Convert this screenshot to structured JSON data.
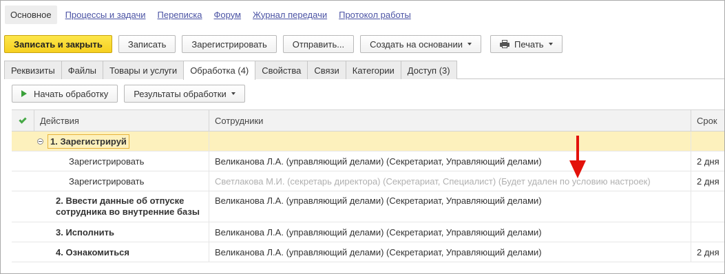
{
  "nav": {
    "items": [
      {
        "label": "Основное",
        "active": true
      },
      {
        "label": "Процессы и задачи"
      },
      {
        "label": "Переписка"
      },
      {
        "label": "Форум"
      },
      {
        "label": "Журнал передачи"
      },
      {
        "label": "Протокол работы"
      }
    ]
  },
  "toolbar": {
    "save_close": "Записать и закрыть",
    "save": "Записать",
    "register": "Зарегистрировать",
    "send": "Отправить...",
    "create_based": "Создать на основании",
    "print": "Печать",
    "print_icon": "printer-icon"
  },
  "tabs": [
    {
      "label": "Реквизиты"
    },
    {
      "label": "Файлы"
    },
    {
      "label": "Товары и услуги"
    },
    {
      "label": "Обработка (4)",
      "active": true
    },
    {
      "label": "Свойства"
    },
    {
      "label": "Связи"
    },
    {
      "label": "Категории"
    },
    {
      "label": "Доступ (3)"
    }
  ],
  "subtoolbar": {
    "start": "Начать обработку",
    "results": "Результаты обработки",
    "start_icon": "play-icon"
  },
  "table": {
    "headers": {
      "check_icon": "checkmark-icon",
      "actions": "Действия",
      "employees": "Сотрудники",
      "deadline": "Срок"
    },
    "rows": [
      {
        "action": "1. Зарегистрируй",
        "employee": "",
        "deadline": "",
        "type": "group"
      },
      {
        "action": "Зарегистрировать",
        "employee": "Великанова Л.А. (управляющий делами) (Секретариат, Управляющий делами)",
        "deadline": "2 дня",
        "type": "sub"
      },
      {
        "action": "Зарегистрировать",
        "employee": "Светлакова М.И. (секретарь директора) (Секретариат, Специалист)  (Будет удален по условию настроек)",
        "deadline": "2 дня",
        "type": "sub-muted"
      },
      {
        "action": "2. Ввести данные об отпуске сотрудника во внутренние базы",
        "employee": "Великанова Л.А. (управляющий делами) (Секретариат, Управляющий делами)",
        "deadline": "",
        "type": "step-tall"
      },
      {
        "action": "3. Исполнить",
        "employee": "Великанова Л.А. (управляющий делами) (Секретариат, Управляющий делами)",
        "deadline": "",
        "type": "step"
      },
      {
        "action": "4. Ознакомиться",
        "employee": "Великанова Л.А. (управляющий делами) (Секретариат, Управляющий делами)",
        "deadline": "2 дня",
        "type": "step"
      }
    ]
  },
  "annotation": {
    "color": "#e3120b",
    "icon": "arrow-down-icon"
  }
}
